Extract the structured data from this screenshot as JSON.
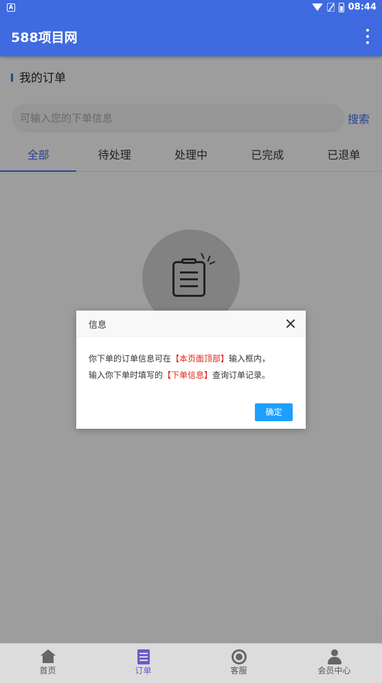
{
  "status_bar": {
    "time": "08:44"
  },
  "app_bar": {
    "title": "588项目网"
  },
  "section": {
    "title": "我的订单"
  },
  "search": {
    "placeholder": "可输入您的下单信息",
    "value": "",
    "button_label": "搜索"
  },
  "tabs": [
    {
      "label": "全部",
      "active": true
    },
    {
      "label": "待处理",
      "active": false
    },
    {
      "label": "处理中",
      "active": false
    },
    {
      "label": "已完成",
      "active": false
    },
    {
      "label": "已退单",
      "active": false
    }
  ],
  "dialog": {
    "title": "信息",
    "line1_a": "你下单的订单信息可在",
    "line1_hl": "【本页面顶部】",
    "line1_b": "输入框内，",
    "line2_a": "输入你下单时填写的",
    "line2_hl": "【下单信息】",
    "line2_b": "查询订单记录。",
    "ok_label": "确定",
    "highlight_color": "#e0251b"
  },
  "bottom_nav": [
    {
      "label": "首页",
      "icon": "home-icon"
    },
    {
      "label": "订单",
      "icon": "order-icon",
      "active": true
    },
    {
      "label": "客服",
      "icon": "customer-service-icon"
    },
    {
      "label": "会员中心",
      "icon": "member-icon"
    }
  ],
  "colors": {
    "primary": "#3f6ae0",
    "dialog_button": "#1e9fff"
  }
}
